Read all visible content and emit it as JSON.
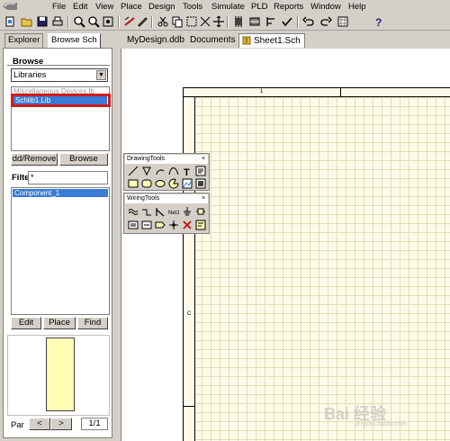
{
  "menu": {
    "items": [
      {
        "label": "File"
      },
      {
        "label": "Edit"
      },
      {
        "label": "View"
      },
      {
        "label": "Place"
      },
      {
        "label": "Design"
      },
      {
        "label": "Tools"
      },
      {
        "label": "Simulate"
      },
      {
        "label": "PLD"
      },
      {
        "label": "Reports"
      },
      {
        "label": "Window"
      },
      {
        "label": "Help"
      }
    ]
  },
  "toolbar": {
    "icons": [
      "open-folder-icon",
      "save-icon",
      "print-icon",
      "zoom-in-icon",
      "zoom-out-icon",
      "zoom-fit-icon",
      "wire-icon",
      "pencil-icon",
      "cut-icon",
      "copy-icon",
      "paste-icon",
      "select-icon",
      "deselect-icon",
      "move-icon",
      "hierarchy-icon",
      "library-icon",
      "align-icon",
      "undo-icon",
      "redo-icon",
      "help-icon"
    ]
  },
  "panel": {
    "tabs": [
      "Explorer",
      "Browse Sch"
    ],
    "browse_group_label": "Browse",
    "browse_select_value": "Libraries",
    "library_list": {
      "faded_item": "Miscellaneous Devices.lb",
      "selected_item": "Schlib1.Lib"
    },
    "add_remove_label": "dd/Remove",
    "browse_button_label": "Browse",
    "filter_label": "Filte",
    "filter_value": "*",
    "component_list": {
      "selected_item": "Component_1"
    },
    "edit_button_label": "Edit",
    "place_button_label": "Place",
    "find_button_label": "Find",
    "part_label": "Par",
    "part_count": "1/1"
  },
  "doc_tabs": [
    {
      "label": "MyDesign.ddb"
    },
    {
      "label": "Documents"
    },
    {
      "label": "Sheet1.Sch"
    }
  ],
  "sheet": {
    "zone_top": "1",
    "zone_left": "C"
  },
  "palettes": {
    "drawing_title": "DrawingTools",
    "wiring_title": "WiringTools",
    "close_symbol": "×"
  },
  "watermark": {
    "text": "Bai 经验",
    "sub": "jingyan.baidu.com"
  },
  "colors": {
    "accent_red": "#d11b1b",
    "selection_blue": "#3a7bd5",
    "sheet_bg": "#fdfbe8"
  }
}
